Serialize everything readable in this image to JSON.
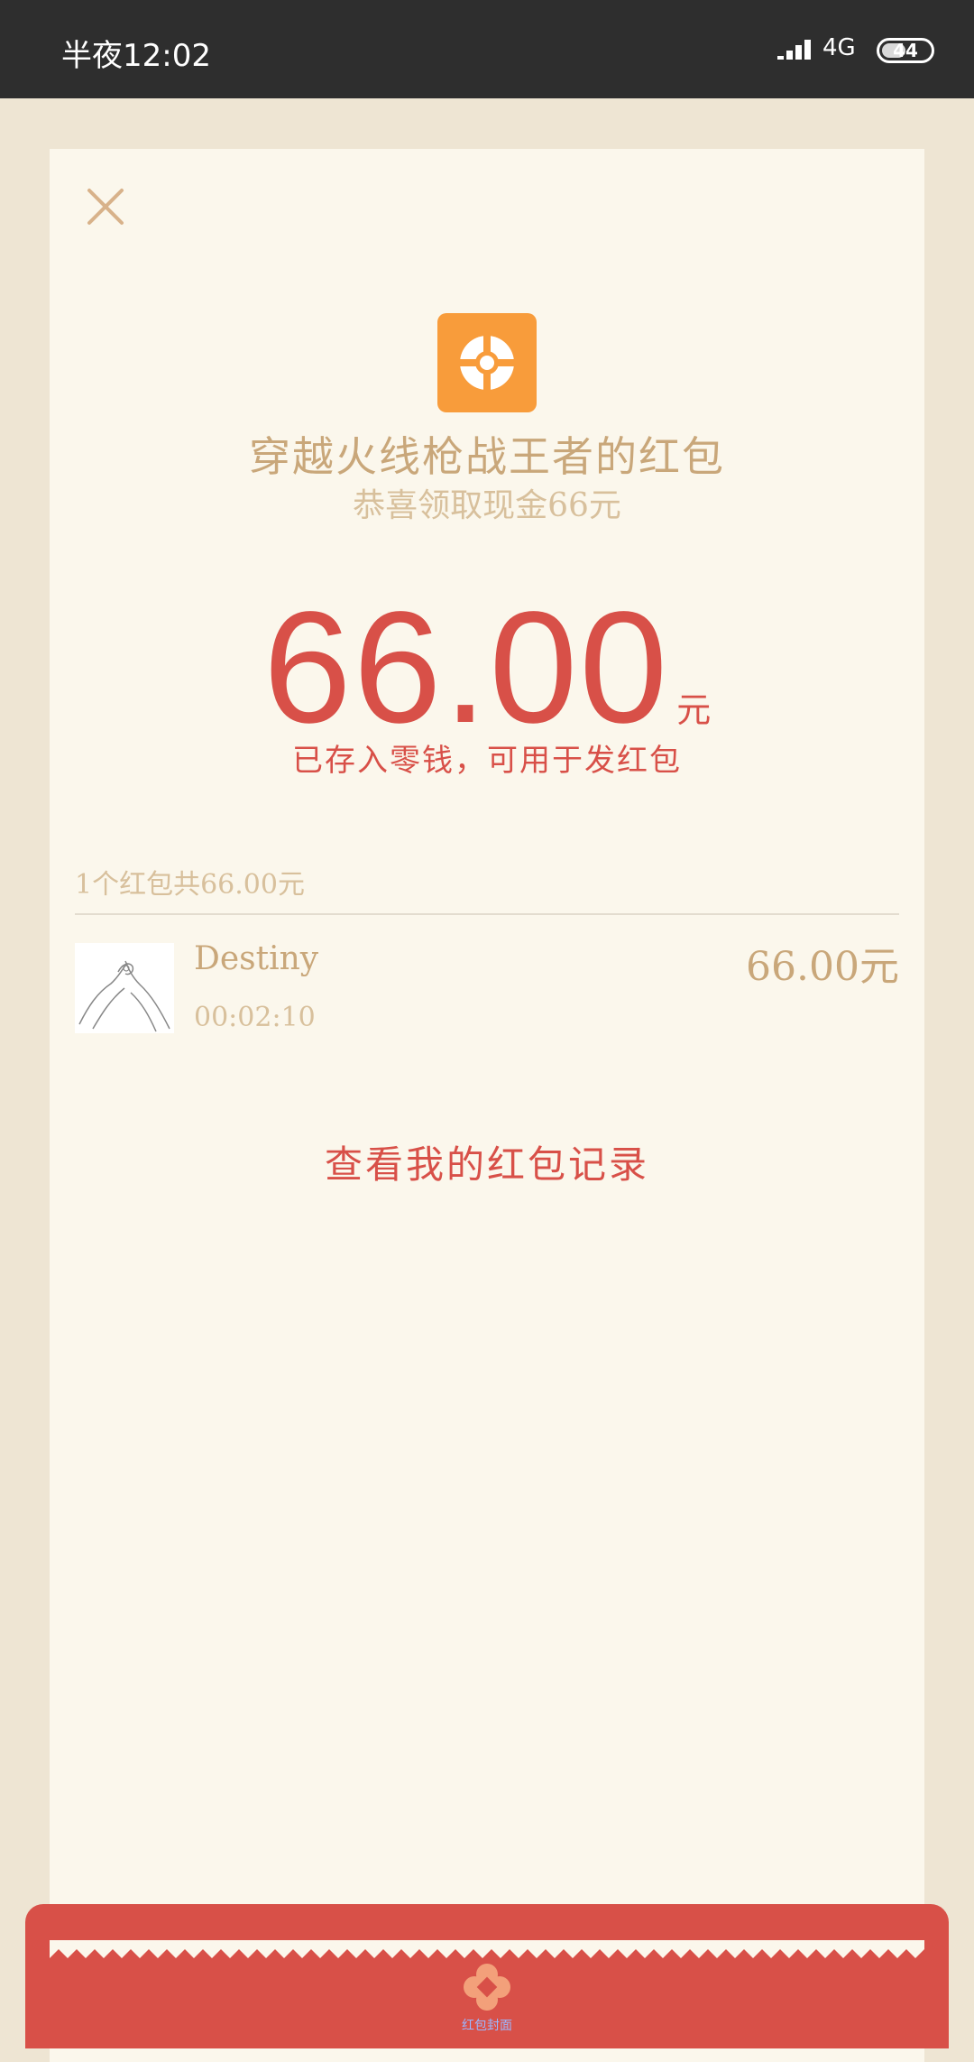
{
  "status_bar": {
    "time": "半夜12:02",
    "network": "4G",
    "battery": "44"
  },
  "card": {
    "title": "穿越火线枪战王者的红包",
    "subtitle": "恭喜领取现金66元",
    "amount": "66.00",
    "amount_unit": "元",
    "amount_note": "已存入零钱，可用于发红包",
    "summary": "1个红包共66.00元",
    "records": [
      {
        "name": "Destiny",
        "time": "00:02:10",
        "amount": "66.00元"
      }
    ],
    "history_link": "查看我的红包记录"
  },
  "bottom": {
    "caption": "红包封面"
  },
  "colors": {
    "accent_red": "#D85048",
    "gold_text": "#C9A77A",
    "light_gold_text": "#D8C09C",
    "card_bg": "#FBF7EC",
    "page_bg": "#EEE5D3",
    "logo_orange": "#F89C3B"
  },
  "icons": [
    "close-icon",
    "app-logo-icon",
    "signal-icon",
    "battery-icon",
    "avatar-hands-icon",
    "flower-badge-icon"
  ]
}
